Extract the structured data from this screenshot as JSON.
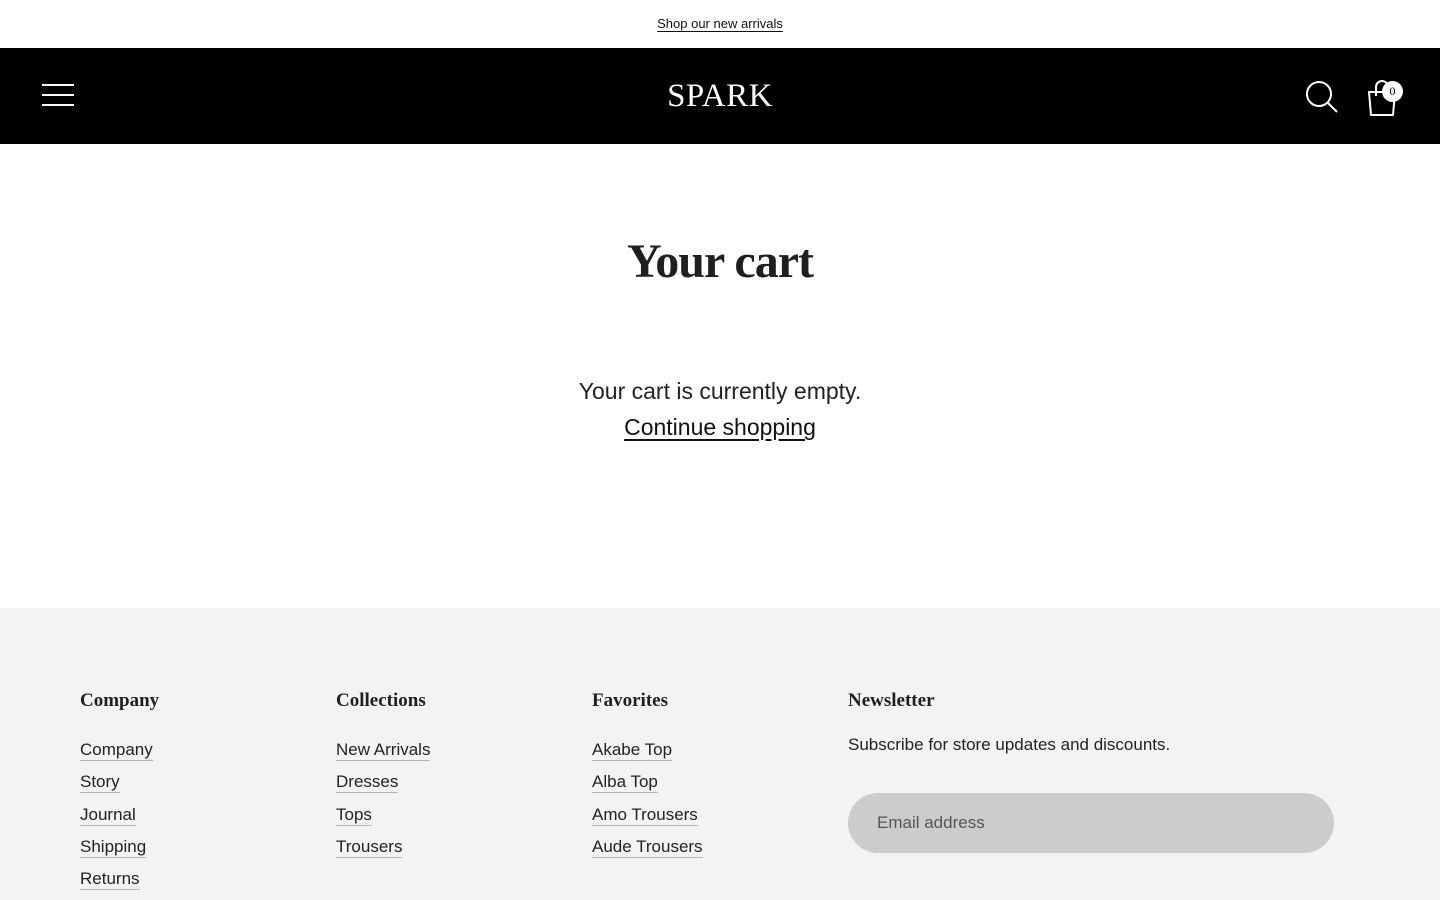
{
  "announcement": {
    "link_text": "Shop our new arrivals"
  },
  "header": {
    "logo": "SPARK",
    "cart_count": "0",
    "icons": {
      "menu": "hamburger-menu-icon",
      "search": "search-icon",
      "cart": "shopping-bag-icon"
    },
    "background_color": "#000000"
  },
  "main": {
    "title": "Your cart",
    "empty_message": "Your cart is currently empty.",
    "continue_link": "Continue shopping"
  },
  "footer": {
    "background_color": "#f3f3f3",
    "company": {
      "heading": "Company",
      "links": [
        "Company",
        "Story",
        "Journal",
        "Shipping",
        "Returns"
      ]
    },
    "collections": {
      "heading": "Collections",
      "links": [
        "New Arrivals",
        "Dresses",
        "Tops",
        "Trousers"
      ]
    },
    "favorites": {
      "heading": "Favorites",
      "links": [
        "Akabe Top",
        "Alba Top",
        "Amo Trousers",
        "Aude Trousers"
      ]
    },
    "newsletter": {
      "heading": "Newsletter",
      "text": "Subscribe for store updates and discounts.",
      "email_placeholder": "Email address"
    }
  }
}
